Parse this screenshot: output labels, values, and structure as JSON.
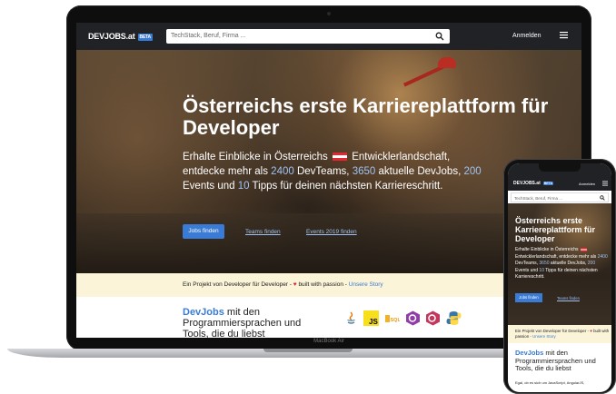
{
  "laptop": {
    "brand_label": "MacBook Air",
    "nav": {
      "logo": "DEVJOBS.at",
      "beta_badge": "BETA",
      "search_placeholder": "TechStack, Beruf, Firma ...",
      "login": "Anmelden",
      "menu_icon": "hamburger-icon"
    },
    "hero": {
      "title": "Österreichs erste Karriereplattform für Developer",
      "sub": {
        "part1": "Erhalte Einblicke in Österreichs",
        "part2": "Entwicklerlandschaft, entdecke mehr als",
        "devteams_count": "2400",
        "part3": "DevTeams,",
        "devjobs_count": "3650",
        "part4": "aktuelle DevJobs,",
        "events_count": "200",
        "part5": "Events und",
        "tips_count": "10",
        "part6": "Tipps für deinen nächsten Karriereschritt."
      },
      "buttons": {
        "jobs": "Jobs finden",
        "teams": "Teams finden",
        "events": "Events 2019 finden"
      }
    },
    "band": {
      "text": "Ein Projekt von Developer für Developer -",
      "heart": "♥",
      "passion": "built with passion -",
      "story": "Unsere Story"
    },
    "content": {
      "devjobs_brand": "DevJobs",
      "devjobs_text": "mit den Programmiersprachen und Tools, die du liebst"
    },
    "tech_icons": [
      "java-icon",
      "javascript-icon",
      "sql-icon",
      "csharp-icon",
      "cpp-icon",
      "python-icon"
    ]
  },
  "phone": {
    "nav": {
      "logo": "DEVJOBS.at",
      "beta_badge": "BETA",
      "login": "Anmelden",
      "search_placeholder": "TechStack, Beruf, Firma ..."
    },
    "hero": {
      "title": "Österreichs erste Karriereplattform für Developer",
      "sub": {
        "part1": "Erhalte Einblicke in Österreichs",
        "part2": "Entwicklerlandschaft, entdecke mehr als",
        "devteams_count": "2400",
        "part3": "DevTeams,",
        "devjobs_count": "3650",
        "part4": "aktuelle DevJobs,",
        "events_count": "200",
        "part5": "Events und",
        "tips_count": "10",
        "part6": "Tipps für deinen nächsten Karriereschritt."
      },
      "buttons": {
        "jobs": "Jobs finden",
        "teams": "Teams finden"
      }
    },
    "band": {
      "text": "Ein Projekt von Developer für Developer -",
      "heart": "♥",
      "passion": "built with passion -",
      "story": "Unsere Story"
    },
    "content": {
      "devjobs_brand": "DevJobs",
      "devjobs_text": "mit den Programmiersprachen und Tools, die du liebst",
      "body_text": "Egal, ob es sich um JavaScript, AngularJS,"
    }
  },
  "colors": {
    "accent": "#3a7bd5",
    "nav_bg": "#212226",
    "band_bg": "#fbf4d8",
    "heart": "#d0263a"
  }
}
